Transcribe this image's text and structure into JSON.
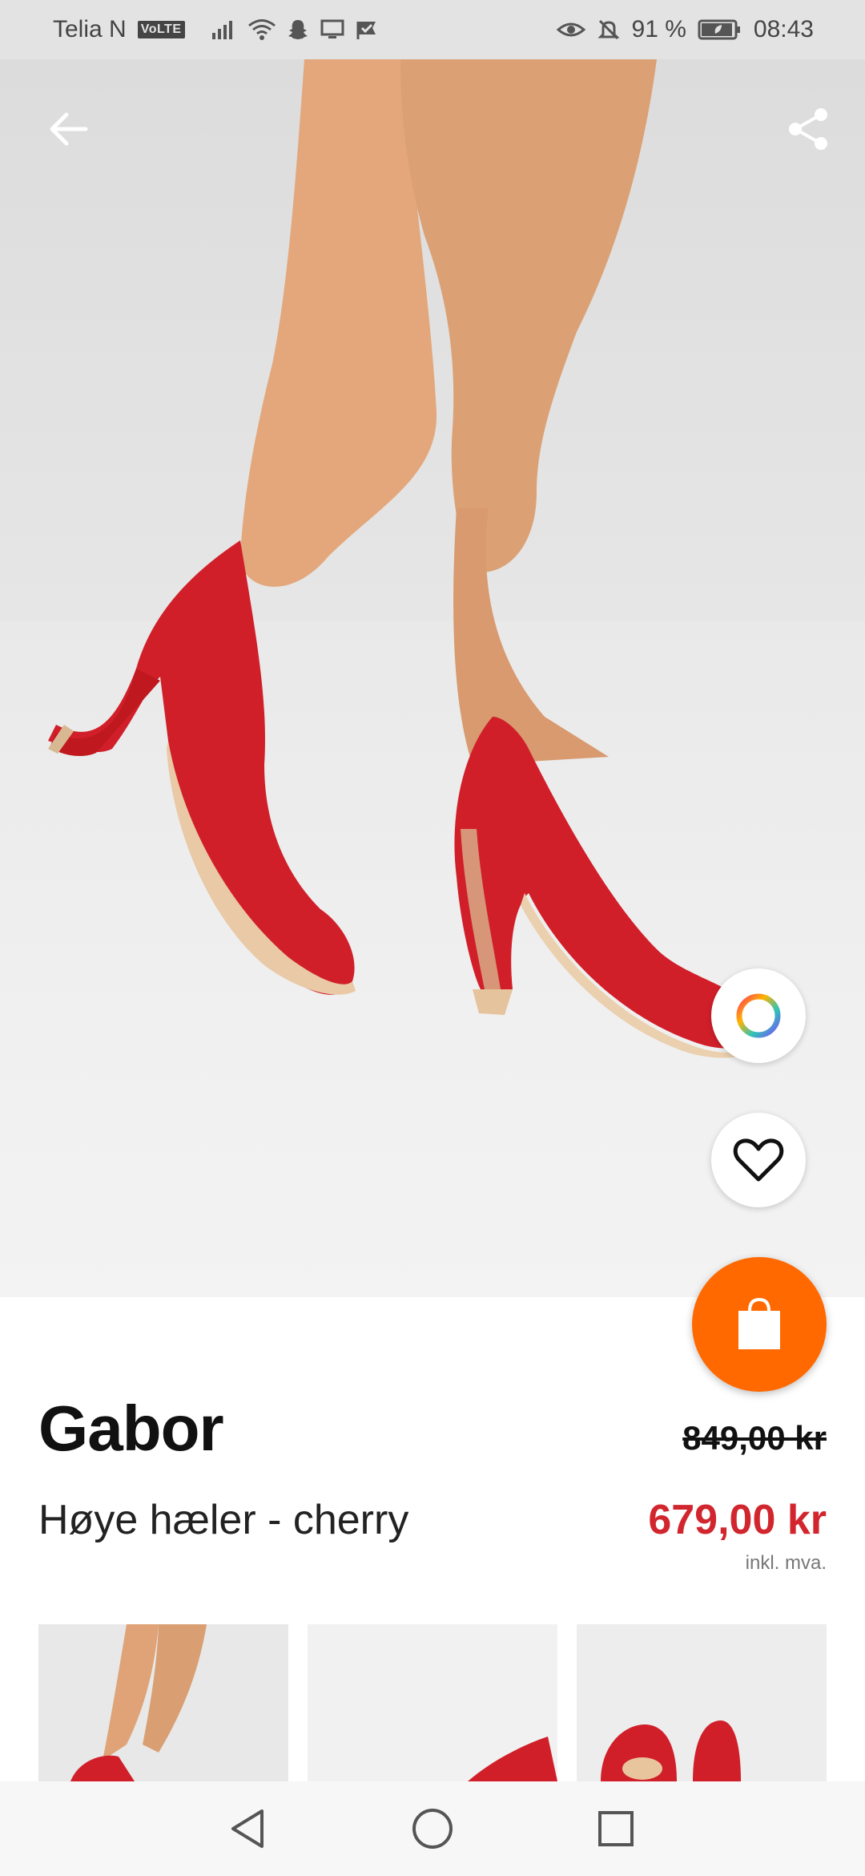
{
  "status_bar": {
    "carrier": "Telia N",
    "volte": "VoLTE",
    "battery_percent": "91 %",
    "time": "08:43"
  },
  "product": {
    "brand": "Gabor",
    "name": "Høye hæler - cherry",
    "original_price": "849,00 kr",
    "sale_price": "679,00 kr",
    "vat_note": "inkl. mva."
  },
  "colors": {
    "accent": "#ff6900",
    "sale": "#d1262e",
    "shoe_red": "#d11f2a"
  },
  "icons": {
    "back": "arrow-left-icon",
    "share": "share-icon",
    "color_picker": "color-ring-icon",
    "wishlist": "heart-icon",
    "cart": "shopping-bag-icon"
  }
}
